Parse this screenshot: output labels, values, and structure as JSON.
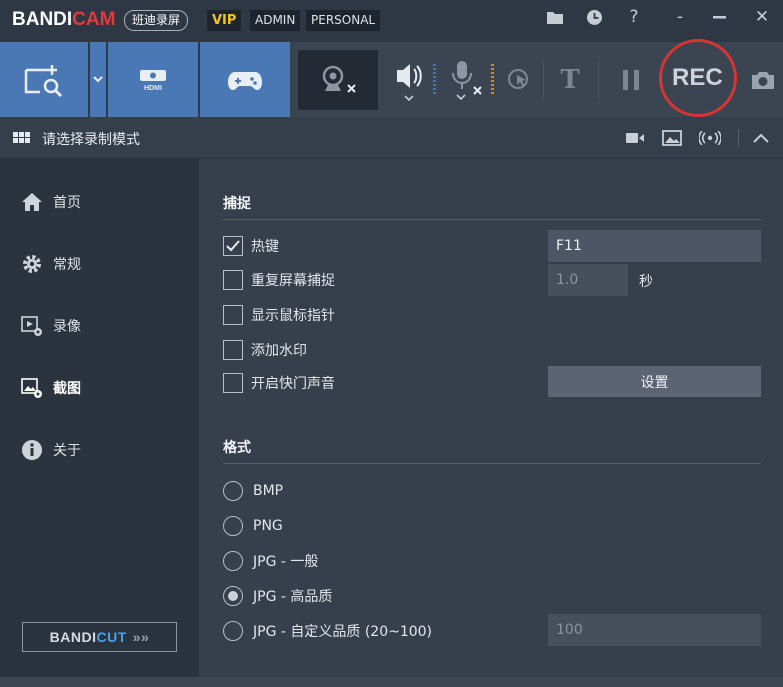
{
  "titlebar": {
    "logo_main": "BANDI",
    "logo_accent": "CAM",
    "logo_cn": "班迪录屏",
    "tag_vip": "VIP",
    "tag_admin": "ADMIN",
    "tag_personal": "PERSONAL",
    "icon_folder": "folder-icon",
    "icon_clock": "clock-icon",
    "help_label": "?",
    "minimize_label": "-",
    "close_label": "✕"
  },
  "toolbar": {
    "rec_label": "REC",
    "text_tool_label": "T",
    "hdmi_label": "HDMI"
  },
  "modebar": {
    "title": "请选择录制模式"
  },
  "sidebar": {
    "items": [
      {
        "label": "首页",
        "icon": "home-icon"
      },
      {
        "label": "常规",
        "icon": "gear-icon"
      },
      {
        "label": "录像",
        "icon": "video-settings-icon"
      },
      {
        "label": "截图",
        "icon": "image-settings-icon"
      },
      {
        "label": "关于",
        "icon": "info-icon"
      }
    ],
    "bandicut_main": "BANDI",
    "bandicut_accent": "CUT",
    "bandicut_arrows": "»»"
  },
  "capture": {
    "title": "捕捉",
    "hotkey_label": "热键",
    "hotkey_checked": true,
    "hotkey_value": "F11",
    "repeat_label": "重复屏幕捕捉",
    "repeat_checked": false,
    "repeat_value": "1.0",
    "repeat_unit": "秒",
    "cursor_label": "显示鼠标指针",
    "cursor_checked": false,
    "watermark_label": "添加水印",
    "watermark_checked": false,
    "shutter_label": "开启快门声音",
    "shutter_checked": false,
    "settings_button": "设置"
  },
  "format": {
    "title": "格式",
    "options": [
      {
        "label": "BMP",
        "selected": false
      },
      {
        "label": "PNG",
        "selected": false
      },
      {
        "label": "JPG - 一般",
        "selected": false
      },
      {
        "label": "JPG - 高品质",
        "selected": true
      },
      {
        "label": "JPG - 自定义品质 (20~100)",
        "selected": false
      }
    ],
    "custom_quality_value": "100"
  },
  "colors": {
    "accent_blue": "#4a78b5",
    "rec_red": "#d83434",
    "logo_red": "#e23a3a",
    "vip_gold": "#f5c518"
  }
}
